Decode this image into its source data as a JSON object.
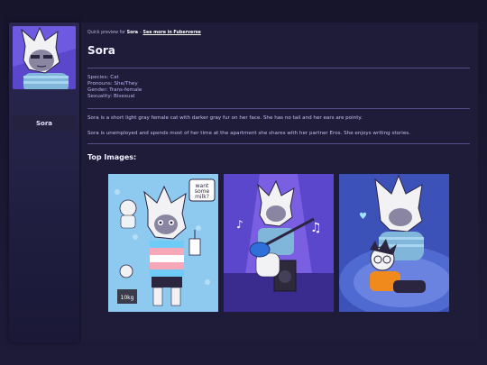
{
  "sidebar": {
    "name": "Sora"
  },
  "header": {
    "breadcrumb_prefix": "Quick preview for",
    "breadcrumb_name": "Sora",
    "breadcrumb_separator": "–",
    "breadcrumb_link": "See more in Fuberverse"
  },
  "profile": {
    "title": "Sora",
    "facts": [
      "Species: Cat",
      "Pronouns: She/They",
      "Gender: Trans-female",
      "Sexuality: Bisexual"
    ],
    "description_1": "Sora is a short light gray female cat with darker gray fur on her face. She has no tail and her ears are pointy.",
    "description_2": "Sora is unemployed and spends most of her time at the apartment she shares with her partner Eros. She enjoys writing stories."
  },
  "gallery": {
    "heading": "Top Images:",
    "images": [
      {
        "alt": "Sora holding a milk carton",
        "speech": "want some milk?",
        "weight_label": "10kg"
      },
      {
        "alt": "Sora playing a blue guitar on stage"
      },
      {
        "alt": "Sora sleeping with a friend in an orange shirt"
      }
    ]
  },
  "colors": {
    "accent": "#5a47c8",
    "panel": "#1e1c38",
    "text": "#d8d3f0"
  }
}
